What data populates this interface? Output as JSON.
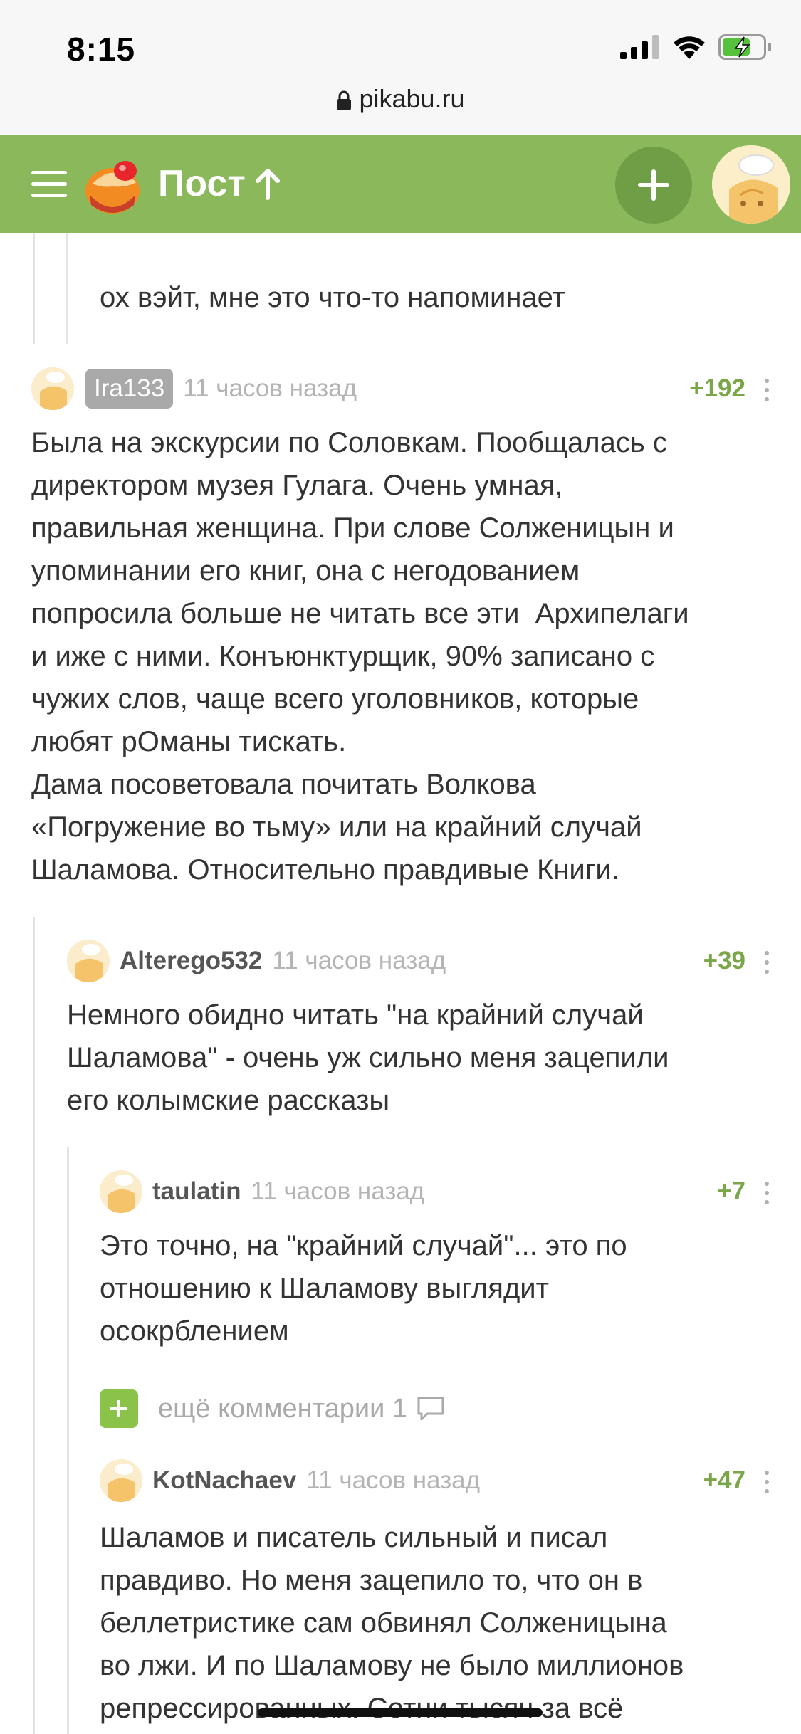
{
  "status": {
    "time": "8:15",
    "url": "pikabu.ru"
  },
  "header": {
    "title": "Пост"
  },
  "comments": [
    {
      "text": "ох вэйт, мне это что-то напоминает"
    },
    {
      "author": "Ira133",
      "ago": "11 часов назад",
      "rating": "+192",
      "text": "Была на экскурсии по Соловкам. Пообщалась с\nдиректором музея Гулага. Очень умная,\nправильная женщина. При слове Солженицын и\nупоминании его книг, она с негодованием\nпопросила больше не читать все эти  Архипелаги\nи иже с ними. Конъюнктурщик, 90% записано с\nчужих слов, чаще всего уголовников, которые\nлюбят рОманы тискать.\nДама посоветовала почитать Волкова\n«Погружение во тьму» или на крайний случай\nШаламова. Относительно правдивые Книги."
    },
    {
      "author": "Alterego532",
      "ago": "11 часов назад",
      "rating": "+39",
      "text": "Немного обидно читать \"на крайний случай\nШаламова\" - очень уж сильно меня зацепили\nего колымские рассказы"
    },
    {
      "author": "taulatin",
      "ago": "11 часов назад",
      "rating": "+7",
      "text": "Это точно, на \"крайний случай\"... это по\nотношению к Шаламову выглядит\nосокрблением"
    },
    {
      "author": "KotNachaev",
      "ago": "11 часов назад",
      "rating": "+47",
      "text": "Шаламов и писатель сильный и писал\nправдиво. Но меня зацепило то, что он в\nбеллетристике сам обвинял Солженицына\nво лжи. И по Шаламову не было миллионов\nрепрессированных. Сотни тысяч за всё"
    }
  ],
  "more_comments": {
    "label": "ещё комментарии 1"
  }
}
